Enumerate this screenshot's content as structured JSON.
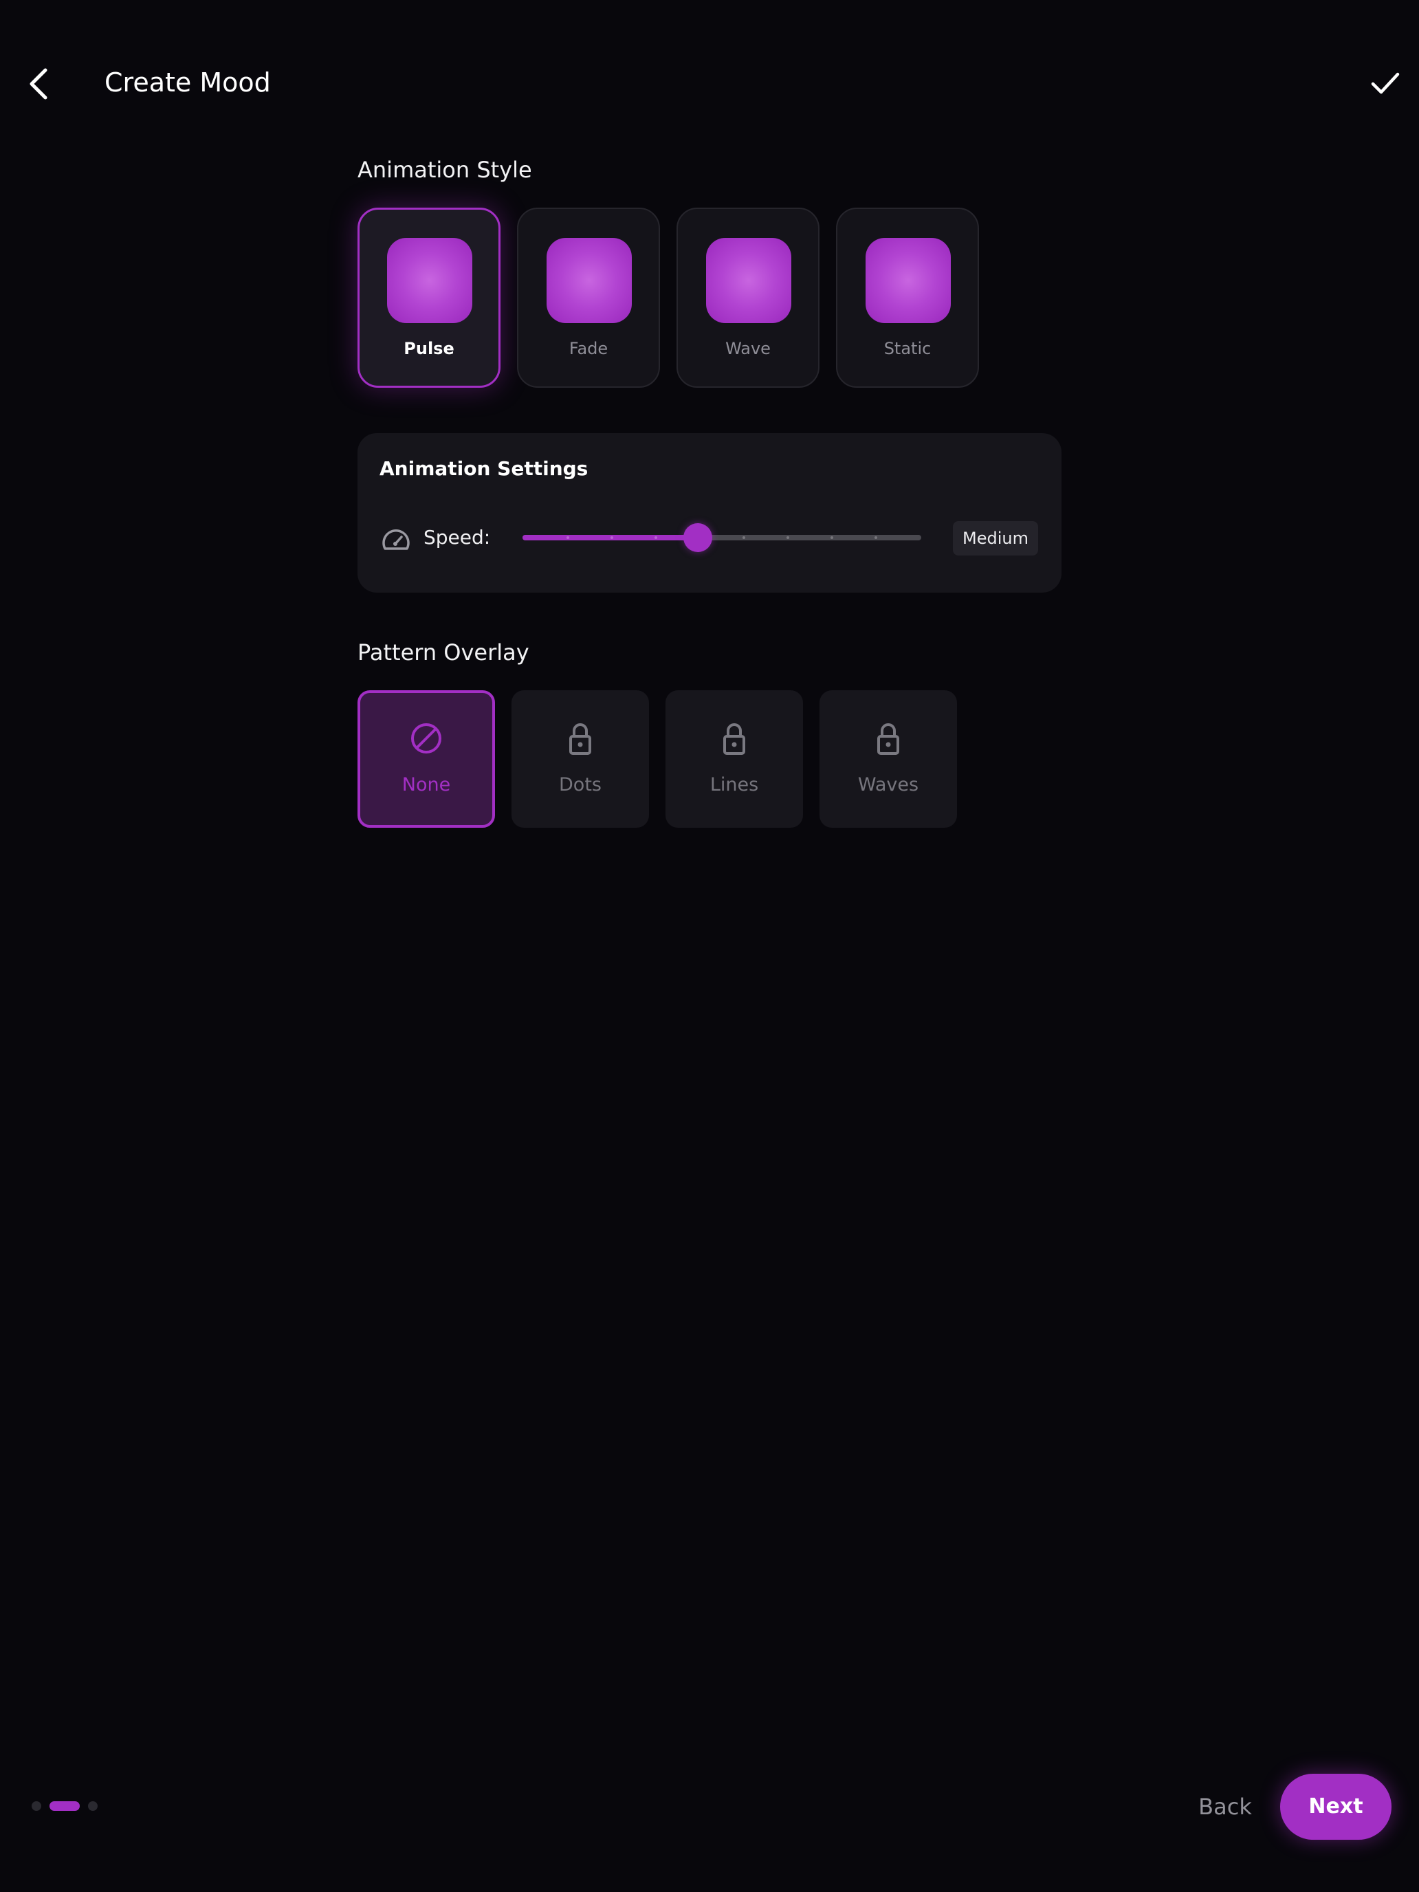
{
  "header": {
    "title": "Create Mood",
    "back_icon": "chevron-left-icon",
    "confirm_icon": "checkmark-icon"
  },
  "animation_style": {
    "title": "Animation Style",
    "options": [
      {
        "label": "Pulse",
        "selected": true
      },
      {
        "label": "Fade",
        "selected": false
      },
      {
        "label": "Wave",
        "selected": false
      },
      {
        "label": "Static",
        "selected": false
      }
    ]
  },
  "animation_settings": {
    "title": "Animation Settings",
    "speed": {
      "icon": "speedometer-icon",
      "label": "Speed:",
      "value_fraction": 0.44,
      "value_label": "Medium"
    }
  },
  "pattern_overlay": {
    "title": "Pattern Overlay",
    "options": [
      {
        "label": "None",
        "icon": "none-icon",
        "selected": true,
        "locked": false
      },
      {
        "label": "Dots",
        "icon": "lock-icon",
        "selected": false,
        "locked": true
      },
      {
        "label": "Lines",
        "icon": "lock-icon",
        "selected": false,
        "locked": true
      },
      {
        "label": "Waves",
        "icon": "lock-icon",
        "selected": false,
        "locked": true
      }
    ]
  },
  "footer": {
    "step_current": 2,
    "step_total": 3,
    "back_label": "Back",
    "next_label": "Next"
  },
  "colors": {
    "accent": "#a22fc4",
    "background": "#08070c",
    "card": "#16151b"
  }
}
